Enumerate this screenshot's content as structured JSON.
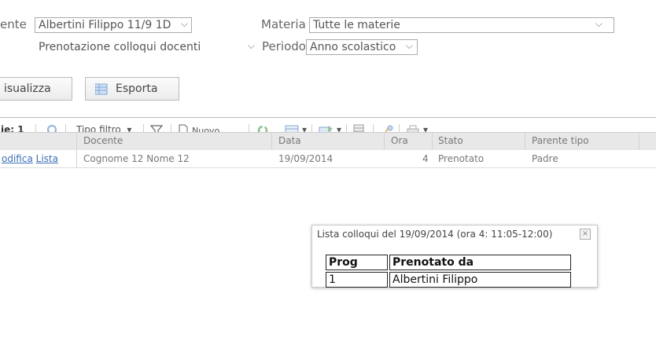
{
  "filters": {
    "studente_label": "ente",
    "studente_value": "Albertini Filippo 11/9 1D",
    "tipo_value": "Prenotazione colloqui docenti",
    "materia_label": "Materia",
    "materia_value": "Tutte le materie",
    "periodo_label": "Periodo",
    "periodo_value": "Anno scolastico"
  },
  "actions": {
    "visualizza": "isualizza",
    "esporta": "Esporta"
  },
  "toolbar": {
    "page_label": "ie: 1",
    "tipo_filtro": "Tipo filtro",
    "nuovo": "Nuovo"
  },
  "grid": {
    "headers": [
      "Docente",
      "Data",
      "Ora",
      "Stato",
      "Parente tipo"
    ],
    "row": {
      "link_modifica": "odifica",
      "link_lista": "Lista",
      "docente": "Cognome 12 Nome 12",
      "data": "19/09/2014",
      "ora": "4",
      "stato": "Prenotato",
      "parente_tipo": "Padre"
    }
  },
  "popup": {
    "title": "Lista colloqui del 19/09/2014 (ora 4: 11:05-12:00)",
    "close": "×",
    "col_prog": "Prog",
    "col_prenotato": "Prenotato da",
    "rows": [
      {
        "prog": "1",
        "prenotato": "Albertini Filippo"
      }
    ]
  },
  "icons": [
    "search-icon",
    "filter-icon",
    "new-doc-icon",
    "refresh-icon",
    "grid-icon",
    "export-icon",
    "columns-icon",
    "tools-icon",
    "print-icon",
    "excel-icon"
  ]
}
